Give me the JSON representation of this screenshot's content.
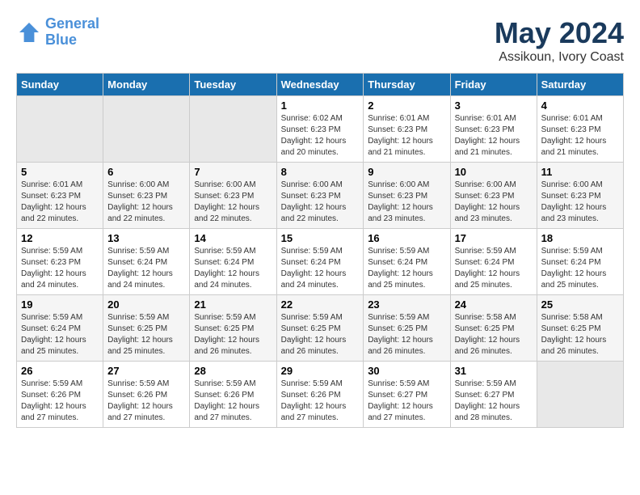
{
  "logo": {
    "line1": "General",
    "line2": "Blue"
  },
  "title": "May 2024",
  "subtitle": "Assikoun, Ivory Coast",
  "weekdays": [
    "Sunday",
    "Monday",
    "Tuesday",
    "Wednesday",
    "Thursday",
    "Friday",
    "Saturday"
  ],
  "weeks": [
    [
      {
        "day": "",
        "info": ""
      },
      {
        "day": "",
        "info": ""
      },
      {
        "day": "",
        "info": ""
      },
      {
        "day": "1",
        "info": "Sunrise: 6:02 AM\nSunset: 6:23 PM\nDaylight: 12 hours\nand 20 minutes."
      },
      {
        "day": "2",
        "info": "Sunrise: 6:01 AM\nSunset: 6:23 PM\nDaylight: 12 hours\nand 21 minutes."
      },
      {
        "day": "3",
        "info": "Sunrise: 6:01 AM\nSunset: 6:23 PM\nDaylight: 12 hours\nand 21 minutes."
      },
      {
        "day": "4",
        "info": "Sunrise: 6:01 AM\nSunset: 6:23 PM\nDaylight: 12 hours\nand 21 minutes."
      }
    ],
    [
      {
        "day": "5",
        "info": "Sunrise: 6:01 AM\nSunset: 6:23 PM\nDaylight: 12 hours\nand 22 minutes."
      },
      {
        "day": "6",
        "info": "Sunrise: 6:00 AM\nSunset: 6:23 PM\nDaylight: 12 hours\nand 22 minutes."
      },
      {
        "day": "7",
        "info": "Sunrise: 6:00 AM\nSunset: 6:23 PM\nDaylight: 12 hours\nand 22 minutes."
      },
      {
        "day": "8",
        "info": "Sunrise: 6:00 AM\nSunset: 6:23 PM\nDaylight: 12 hours\nand 22 minutes."
      },
      {
        "day": "9",
        "info": "Sunrise: 6:00 AM\nSunset: 6:23 PM\nDaylight: 12 hours\nand 23 minutes."
      },
      {
        "day": "10",
        "info": "Sunrise: 6:00 AM\nSunset: 6:23 PM\nDaylight: 12 hours\nand 23 minutes."
      },
      {
        "day": "11",
        "info": "Sunrise: 6:00 AM\nSunset: 6:23 PM\nDaylight: 12 hours\nand 23 minutes."
      }
    ],
    [
      {
        "day": "12",
        "info": "Sunrise: 5:59 AM\nSunset: 6:23 PM\nDaylight: 12 hours\nand 24 minutes."
      },
      {
        "day": "13",
        "info": "Sunrise: 5:59 AM\nSunset: 6:24 PM\nDaylight: 12 hours\nand 24 minutes."
      },
      {
        "day": "14",
        "info": "Sunrise: 5:59 AM\nSunset: 6:24 PM\nDaylight: 12 hours\nand 24 minutes."
      },
      {
        "day": "15",
        "info": "Sunrise: 5:59 AM\nSunset: 6:24 PM\nDaylight: 12 hours\nand 24 minutes."
      },
      {
        "day": "16",
        "info": "Sunrise: 5:59 AM\nSunset: 6:24 PM\nDaylight: 12 hours\nand 25 minutes."
      },
      {
        "day": "17",
        "info": "Sunrise: 5:59 AM\nSunset: 6:24 PM\nDaylight: 12 hours\nand 25 minutes."
      },
      {
        "day": "18",
        "info": "Sunrise: 5:59 AM\nSunset: 6:24 PM\nDaylight: 12 hours\nand 25 minutes."
      }
    ],
    [
      {
        "day": "19",
        "info": "Sunrise: 5:59 AM\nSunset: 6:24 PM\nDaylight: 12 hours\nand 25 minutes."
      },
      {
        "day": "20",
        "info": "Sunrise: 5:59 AM\nSunset: 6:25 PM\nDaylight: 12 hours\nand 25 minutes."
      },
      {
        "day": "21",
        "info": "Sunrise: 5:59 AM\nSunset: 6:25 PM\nDaylight: 12 hours\nand 26 minutes."
      },
      {
        "day": "22",
        "info": "Sunrise: 5:59 AM\nSunset: 6:25 PM\nDaylight: 12 hours\nand 26 minutes."
      },
      {
        "day": "23",
        "info": "Sunrise: 5:59 AM\nSunset: 6:25 PM\nDaylight: 12 hours\nand 26 minutes."
      },
      {
        "day": "24",
        "info": "Sunrise: 5:58 AM\nSunset: 6:25 PM\nDaylight: 12 hours\nand 26 minutes."
      },
      {
        "day": "25",
        "info": "Sunrise: 5:58 AM\nSunset: 6:25 PM\nDaylight: 12 hours\nand 26 minutes."
      }
    ],
    [
      {
        "day": "26",
        "info": "Sunrise: 5:59 AM\nSunset: 6:26 PM\nDaylight: 12 hours\nand 27 minutes."
      },
      {
        "day": "27",
        "info": "Sunrise: 5:59 AM\nSunset: 6:26 PM\nDaylight: 12 hours\nand 27 minutes."
      },
      {
        "day": "28",
        "info": "Sunrise: 5:59 AM\nSunset: 6:26 PM\nDaylight: 12 hours\nand 27 minutes."
      },
      {
        "day": "29",
        "info": "Sunrise: 5:59 AM\nSunset: 6:26 PM\nDaylight: 12 hours\nand 27 minutes."
      },
      {
        "day": "30",
        "info": "Sunrise: 5:59 AM\nSunset: 6:27 PM\nDaylight: 12 hours\nand 27 minutes."
      },
      {
        "day": "31",
        "info": "Sunrise: 5:59 AM\nSunset: 6:27 PM\nDaylight: 12 hours\nand 28 minutes."
      },
      {
        "day": "",
        "info": ""
      }
    ]
  ]
}
